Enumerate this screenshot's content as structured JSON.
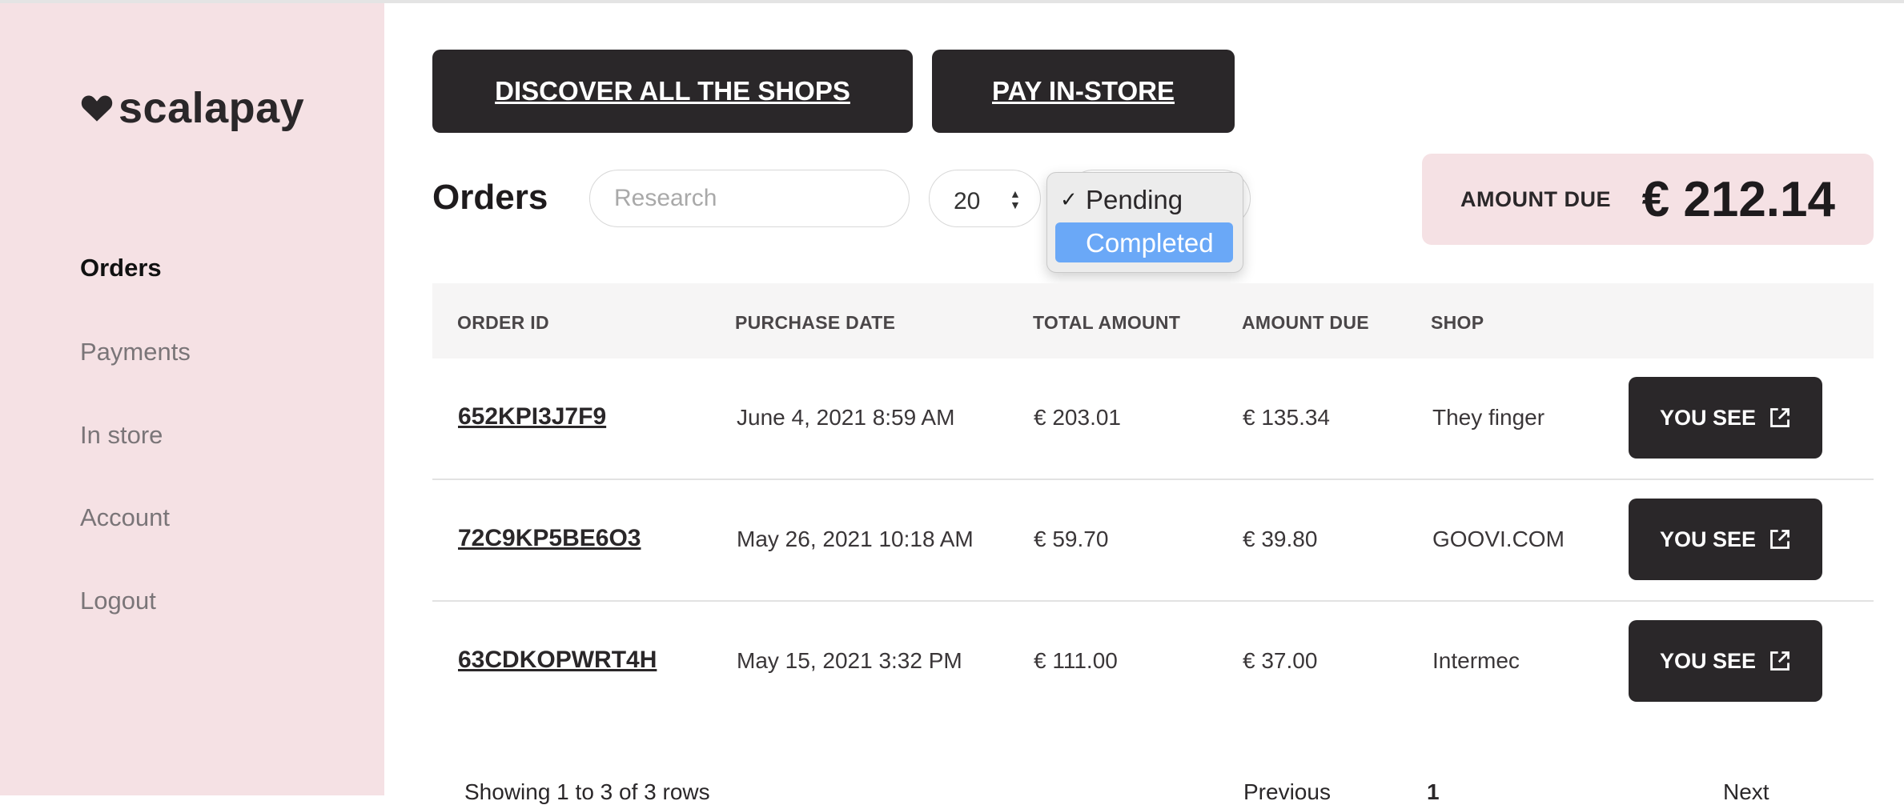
{
  "brand": {
    "name": "scalapay",
    "logo_icon": "heart-icon"
  },
  "sidebar": {
    "items": [
      {
        "label": "Orders",
        "active": true
      },
      {
        "label": "Payments",
        "active": false
      },
      {
        "label": "In store",
        "active": false
      },
      {
        "label": "Account",
        "active": false
      },
      {
        "label": "Logout",
        "active": false
      }
    ]
  },
  "actions": {
    "discover_label": "DISCOVER ALL THE SHOPS",
    "pay_instore_label": "PAY IN-STORE"
  },
  "orders": {
    "title": "Orders",
    "search_placeholder": "Research",
    "rows_per_page": "20"
  },
  "status_dropdown": {
    "options": [
      {
        "label": "Pending",
        "checked": true,
        "highlighted": false
      },
      {
        "label": "Completed",
        "checked": false,
        "highlighted": true
      }
    ]
  },
  "amount_due": {
    "label": "AMOUNT DUE",
    "value": "€ 212.14"
  },
  "table": {
    "headers": [
      "ORDER ID",
      "PURCHASE DATE",
      "TOTAL AMOUNT",
      "AMOUNT DUE",
      "SHOP"
    ],
    "rows": [
      {
        "id": "652KPI3J7F9",
        "date": "June 4, 2021 8:59 AM",
        "total": "€ 203.01",
        "due": "€ 135.34",
        "shop": "They finger",
        "action": "YOU SEE"
      },
      {
        "id": "72C9KP5BE6O3",
        "date": "May 26, 2021 10:18 AM",
        "total": "€ 59.70",
        "due": "€ 39.80",
        "shop": "GOOVI.COM",
        "action": "YOU SEE"
      },
      {
        "id": "63CDKOPWRT4H",
        "date": "May 15, 2021 3:32 PM",
        "total": "€ 111.00",
        "due": "€ 37.00",
        "shop": "Intermec",
        "action": "YOU SEE"
      }
    ]
  },
  "pagination": {
    "summary": "Showing 1 to 3 of 3 rows",
    "prev": "Previous",
    "page": "1",
    "next": "Next"
  },
  "colors": {
    "sidebar_bg": "#f5e1e4",
    "dark_button": "#2a2729",
    "dropdown_highlight": "#6aa8f7"
  }
}
